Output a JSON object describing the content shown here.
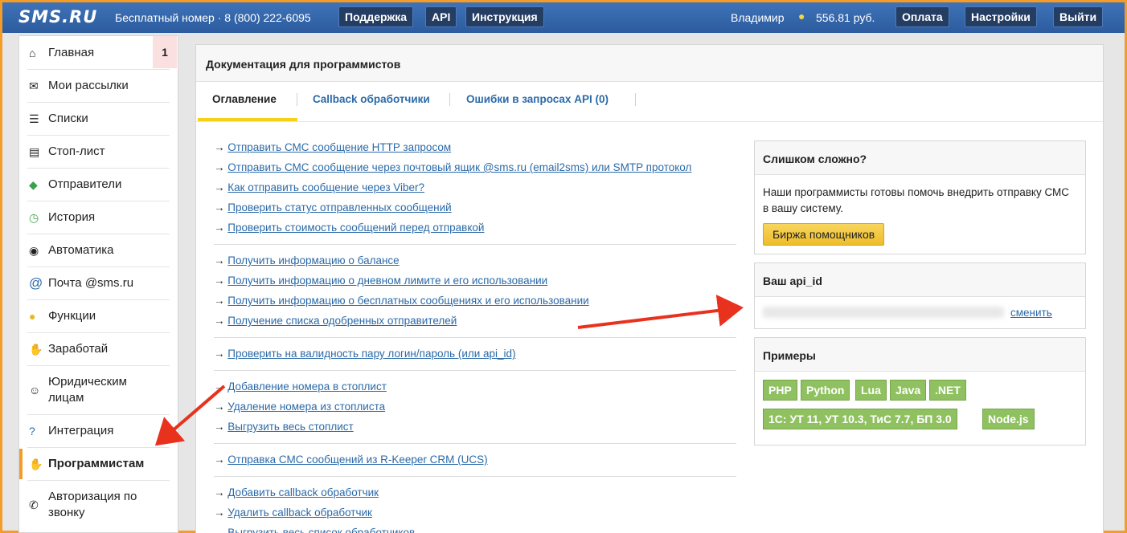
{
  "topbar": {
    "logo": "SMS.RU",
    "phone": "Бесплатный номер · 8 (800) 222-6095",
    "support": "Поддержка",
    "api": "API",
    "manual": "Инструкция",
    "user": "Владимир",
    "balance": "556.81 руб.",
    "pay": "Оплата",
    "settings": "Настройки",
    "logout": "Выйти"
  },
  "sidebar": {
    "items": [
      {
        "label": "Главная",
        "icon": "home-icon",
        "badge": "1"
      },
      {
        "label": "Мои рассылки",
        "icon": "mail-icon"
      },
      {
        "label": "Списки",
        "icon": "list-icon"
      },
      {
        "label": "Стоп-лист",
        "icon": "stoplist-icon"
      },
      {
        "label": "Отправители",
        "icon": "tag-icon"
      },
      {
        "label": "История",
        "icon": "history-icon"
      },
      {
        "label": "Автоматика",
        "icon": "robot-icon"
      },
      {
        "label": "Почта @sms.ru",
        "icon": "at-icon"
      },
      {
        "label": "Функции",
        "icon": "bulb-icon"
      },
      {
        "label": "Заработай",
        "icon": "handshake-icon"
      },
      {
        "label": "Юридическим лицам",
        "icon": "person-icon"
      },
      {
        "label": "Интеграция",
        "icon": "question-icon"
      },
      {
        "label": "Программистам",
        "icon": "hand-icon"
      },
      {
        "label": "Авторизация по звонку",
        "icon": "phone-icon"
      }
    ]
  },
  "main": {
    "title": "Документация для программистов",
    "tabs": [
      "Оглавление",
      "Callback обработчики",
      "Ошибки в запросах API (0)"
    ],
    "arrow": "→",
    "links": [
      "Отправить СМС сообщение HTTP запросом",
      "Отправить СМС сообщение через почтовый ящик @sms.ru (email2sms) или SMTP протокол",
      "Как отправить сообщение через Viber?",
      "Проверить статус отправленных сообщений",
      "Проверить стоимость сообщений перед отправкой",
      "Получить информацию о балансе",
      "Получить информацию о дневном лимите и его использовании",
      "Получить информацию о бесплатных сообщениях и его использовании",
      "Получение списка одобренных отправителей",
      "Проверить на валидность пару логин/пароль (или api_id)",
      "Добавление номера в стоплист",
      "Удаление номера из стоплиста",
      "Выгрузить весь стоплист",
      "Отправка СМС сообщений из R-Keeper CRM (UCS)",
      "Добавить callback обработчик",
      "Удалить callback обработчик",
      "Выгрузить весь список обработчиков"
    ]
  },
  "help": {
    "title": "Слишком сложно?",
    "text": "Наши программисты готовы помочь внедрить отправку СМС в вашу систему.",
    "button": "Биржа помощников"
  },
  "api": {
    "title": "Ваш api_id",
    "change": "сменить"
  },
  "examples": {
    "title": "Примеры",
    "tags": [
      "PHP",
      "Python",
      "Lua",
      "Java",
      ".NET",
      "1С: УТ 11, УТ 10.3, ТиС 7.7, БП 3.0",
      "Node.js"
    ]
  },
  "colors": {
    "accent": "#f39c28",
    "topbar": "#2c5c9f",
    "link": "#2b6aa8",
    "tag": "#8fc160"
  }
}
